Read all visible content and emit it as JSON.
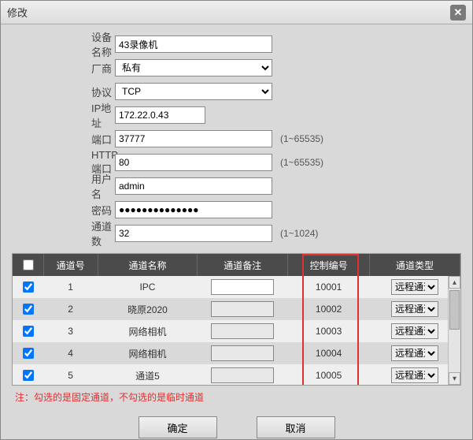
{
  "dialog": {
    "title": "修改"
  },
  "form": {
    "device_name": {
      "label": "设备名称",
      "value": "43录像机"
    },
    "vendor": {
      "label": "厂商",
      "value": "私有"
    },
    "protocol": {
      "label": "协议",
      "value": "TCP"
    },
    "ip": {
      "label": "IP地址",
      "value": "172.22.0.43"
    },
    "port": {
      "label": "端口",
      "value": "37777",
      "hint": "(1~65535)"
    },
    "http_port": {
      "label": "HTTP端口",
      "value": "80",
      "hint": "(1~65535)"
    },
    "user": {
      "label": "用户名",
      "value": "admin"
    },
    "password": {
      "label": "密码",
      "value": "●●●●●●●●●●●●●●"
    },
    "channels": {
      "label": "通道数",
      "value": "32",
      "hint": "(1~1024)"
    }
  },
  "table": {
    "headers": {
      "chk": "",
      "no": "通道号",
      "name": "通道名称",
      "remark": "通道备注",
      "ctrl": "控制编号",
      "type": "通道类型"
    },
    "type_option": "远程通道",
    "rows": [
      {
        "checked": true,
        "no": "1",
        "name": "IPC",
        "remark": "",
        "ctrl": "10001"
      },
      {
        "checked": true,
        "no": "2",
        "name": "晓原2020",
        "remark": "",
        "ctrl": "10002"
      },
      {
        "checked": true,
        "no": "3",
        "name": "网络相机",
        "remark": "",
        "ctrl": "10003"
      },
      {
        "checked": true,
        "no": "4",
        "name": "网络相机",
        "remark": "",
        "ctrl": "10004"
      },
      {
        "checked": true,
        "no": "5",
        "name": "通道5",
        "remark": "",
        "ctrl": "10005"
      }
    ]
  },
  "note": "注：勾选的是固定通道，不勾选的是临时通道",
  "buttons": {
    "ok": "确定",
    "cancel": "取消"
  }
}
